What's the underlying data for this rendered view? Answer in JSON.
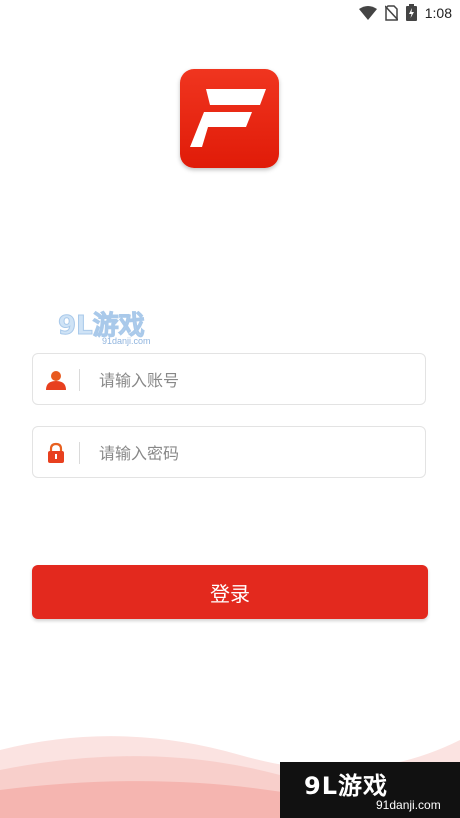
{
  "status_bar": {
    "time": "1:08",
    "icons": [
      "wifi-icon",
      "no-sim-icon",
      "battery-charging-icon"
    ]
  },
  "app": {
    "logo_icon": "f-logo-icon",
    "brand_color": "#e3291e"
  },
  "login_form": {
    "username": {
      "placeholder": "请输入账号",
      "value": "",
      "icon": "user-icon"
    },
    "password": {
      "placeholder": "请输入密码",
      "value": "",
      "icon": "lock-icon"
    },
    "submit_label": "登录"
  },
  "watermark": {
    "brand": "9L游戏",
    "url": "91danji.com",
    "corner_brand": "9L游戏",
    "corner_url": "91danji.com"
  }
}
